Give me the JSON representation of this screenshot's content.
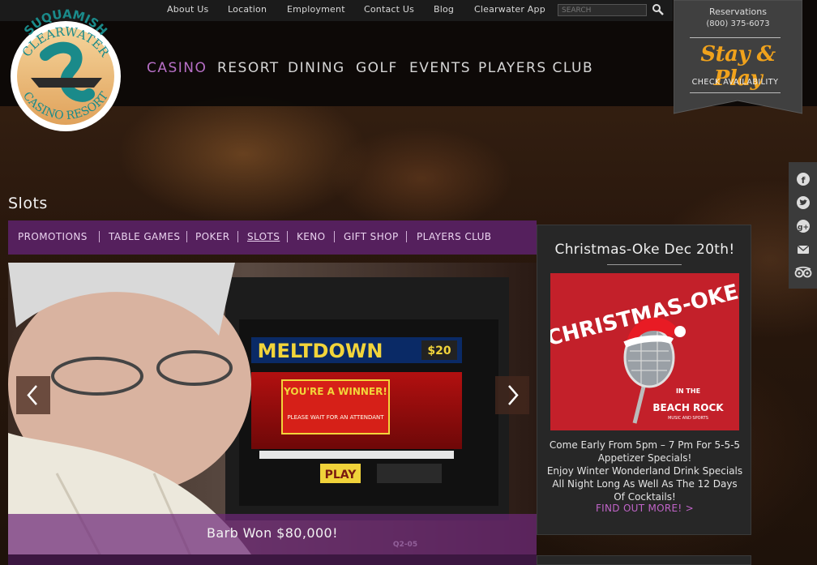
{
  "utility_nav": {
    "links": [
      "About Us",
      "Location",
      "Employment",
      "Contact Us",
      "Blog",
      "Clearwater App"
    ],
    "search_placeholder": "SEARCH"
  },
  "logo": {
    "text_top": "SUQUAMISH",
    "text_middle": "CLEARWATER",
    "text_bottom": "CASINO RESORT"
  },
  "main_nav": {
    "links": [
      "CASINO",
      "RESORT",
      "DINING",
      "GOLF",
      "EVENTS",
      "PLAYERS CLUB"
    ],
    "active": "CASINO"
  },
  "reservations": {
    "title": "Reservations",
    "phone": "(800) 375-6073",
    "slogan": "Stay & Play",
    "cta": "CHECK AVAILABILITY"
  },
  "social": {
    "icons": [
      "facebook-icon",
      "twitter-icon",
      "google-plus-icon",
      "email-icon",
      "tripadvisor-icon"
    ]
  },
  "page": {
    "title": "Slots"
  },
  "sub_nav": {
    "links": [
      "PROMOTIONS",
      "TABLE GAMES",
      "POKER",
      "SLOTS",
      "KENO",
      "GIFT SHOP",
      "PLAYERS CLUB"
    ],
    "active": "SLOTS"
  },
  "slider": {
    "caption": "Barb Won $80,000!",
    "machine_title": "MELTDOWN",
    "machine_denomination": "$20",
    "machine_message": "YOU'RE A WINNER!",
    "machine_attendant": "PLEASE WAIT FOR AN ATTENDANT",
    "machine_play": "PLAY",
    "machine_id": "Q2-05"
  },
  "promo": {
    "title": "Christmas-Oke Dec 20th!",
    "image_title": "CHRISTMAS-OKE",
    "image_sub1": "IN THE",
    "image_sub2": "BEACH ROCK",
    "image_sub3": "MUSIC AND SPORTS",
    "line1": "Come Early From 5pm – 7 Pm For 5-5-5 Appetizer Specials!",
    "line2": "Enjoy Winter Wonderland Drink Specials All Night Long As Well As The 12 Days Of Cocktails!",
    "link": "FIND OUT MORE! >"
  },
  "colors": {
    "accent_purple": "#55205d",
    "active_link": "#b76fc6",
    "slogan_orange": "#f0a21c"
  }
}
